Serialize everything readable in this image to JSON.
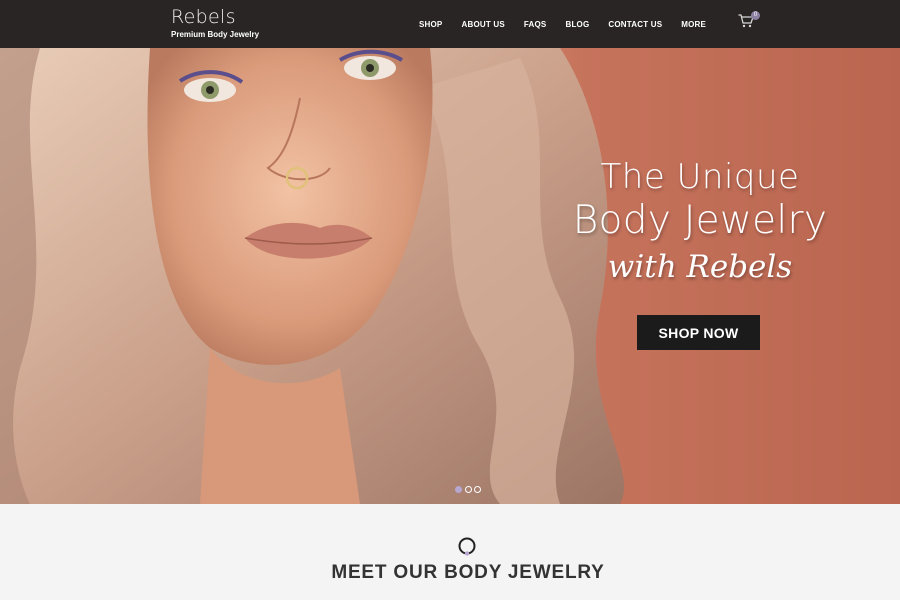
{
  "brand": {
    "name": "Rebels",
    "tagline": "Premium Body Jewelry"
  },
  "nav": {
    "items": [
      {
        "label": "SHOP"
      },
      {
        "label": "ABOUT US"
      },
      {
        "label": "FAQS"
      },
      {
        "label": "BLOG"
      },
      {
        "label": "CONTACT US"
      },
      {
        "label": "MORE"
      }
    ]
  },
  "cart": {
    "count": "0",
    "icon": "shopping-cart-icon"
  },
  "hero": {
    "headline_line1": "The Unique",
    "headline_line2": "Body Jewelry",
    "headline_line3": "with Rebels",
    "cta_label": "SHOP NOW",
    "slides_count": 3,
    "active_slide": 1,
    "accent_color": "#b7a6cf",
    "background_color": "#c6735c"
  },
  "section": {
    "icon": "ring-icon",
    "title": "MEET OUR BODY JEWELRY"
  },
  "colors": {
    "header_bg": "#2a2525",
    "button_bg": "#1c1b1b",
    "page_bg": "#f4f4f4"
  }
}
